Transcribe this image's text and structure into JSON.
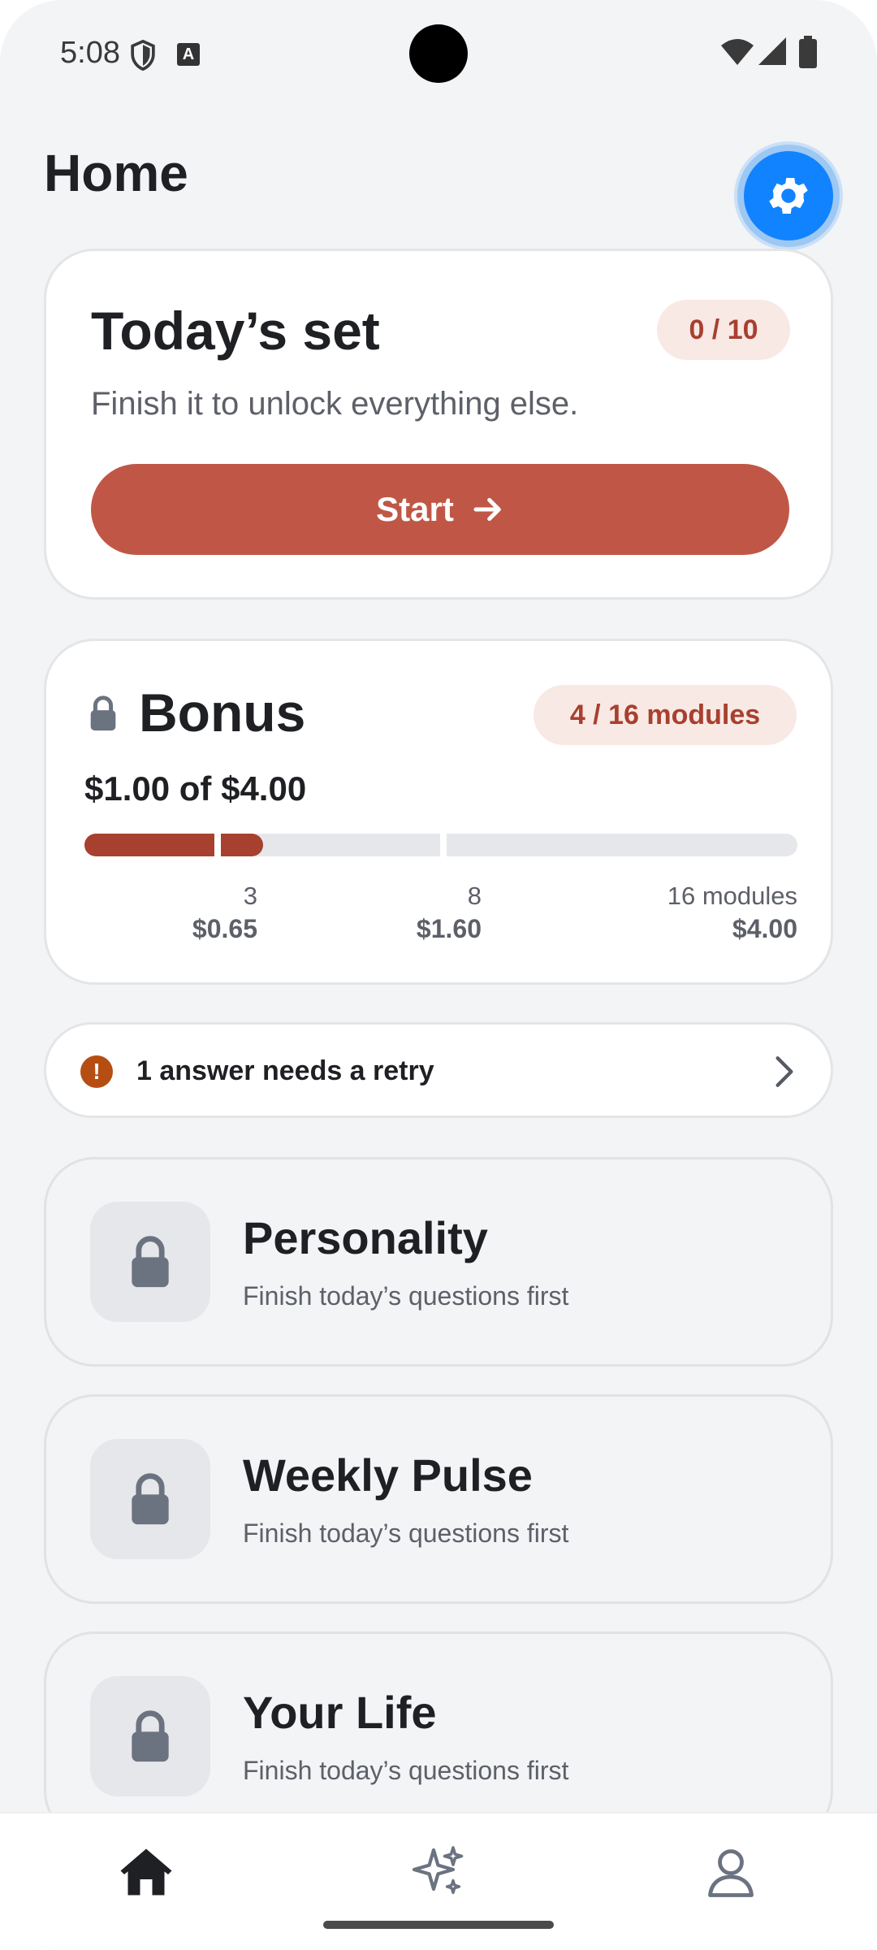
{
  "status_bar": {
    "time": "5:08",
    "notification_letter": "A"
  },
  "header": {
    "title": "Home"
  },
  "today": {
    "title": "Today’s set",
    "progress": "0 / 10",
    "subtitle": "Finish it to unlock everything else.",
    "start_label": "Start"
  },
  "bonus": {
    "title": "Bonus",
    "modules_badge": "4 / 16 modules",
    "amount": "$1.00 of $4.00",
    "progress_modules": 4,
    "total_modules": 16,
    "milestones": [
      {
        "count": "3",
        "value": "$0.65"
      },
      {
        "count": "8",
        "value": "$1.60"
      },
      {
        "count": "16 modules",
        "value": "$4.00"
      }
    ]
  },
  "retry": {
    "icon": "!",
    "text": "1 answer needs a retry"
  },
  "modules": [
    {
      "title": "Personality",
      "subtitle": "Finish today’s questions first"
    },
    {
      "title": "Weekly Pulse",
      "subtitle": "Finish today’s questions first"
    },
    {
      "title": "Your Life",
      "subtitle": "Finish today’s questions first"
    }
  ],
  "nav": {
    "items": [
      "home-icon",
      "sparkles-icon",
      "profile-icon"
    ]
  },
  "colors": {
    "accent": "#c05746",
    "brand_dark": "#a8402f",
    "settings_blue": "#1183ff"
  }
}
